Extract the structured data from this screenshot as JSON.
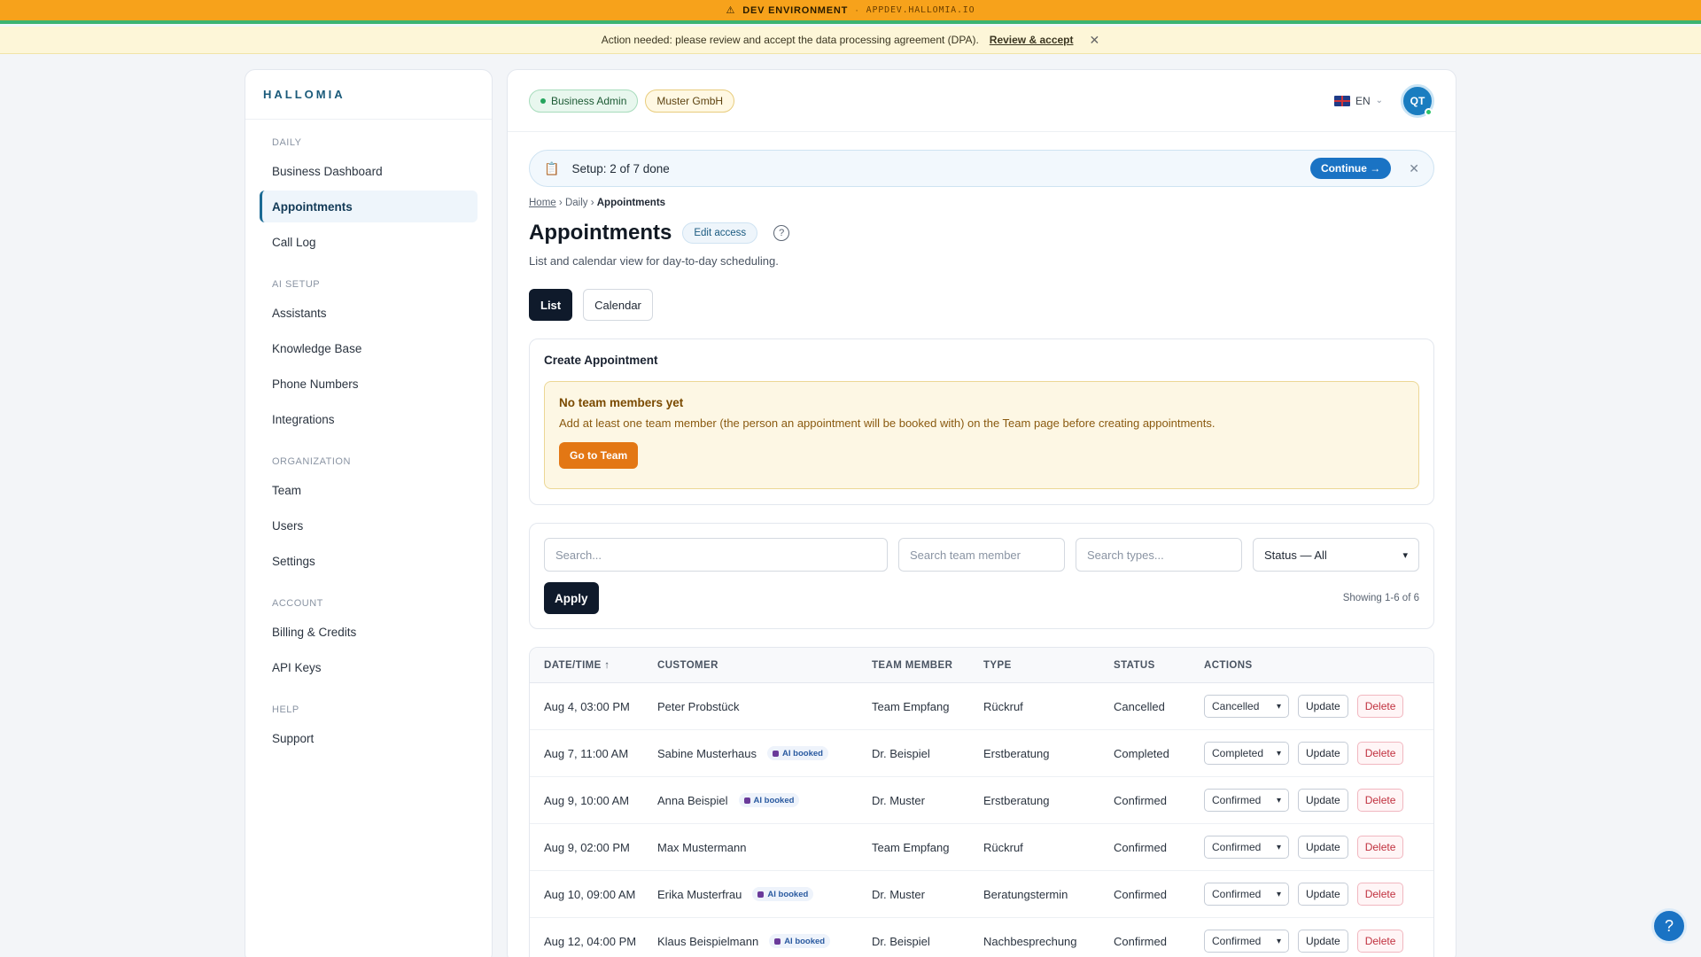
{
  "dev_banner": {
    "icon": "warning-icon",
    "env": "DEV ENVIRONMENT",
    "sep": "·",
    "host": "APPDEV.HALLOMIA.IO"
  },
  "notice": {
    "text": "Action needed: please review and accept the data processing agreement (DPA).",
    "link": "Review & accept",
    "close": "✕"
  },
  "sidebar": {
    "brand": "HALLOMIA",
    "sections": [
      {
        "heading": "DAILY",
        "items": [
          "Business Dashboard",
          "Appointments",
          "Call Log"
        ]
      },
      {
        "heading": "AI SETUP",
        "items": [
          "Assistants",
          "Knowledge Base",
          "Phone Numbers",
          "Integrations"
        ]
      },
      {
        "heading": "ORGANIZATION",
        "items": [
          "Team",
          "Users",
          "Settings"
        ]
      },
      {
        "heading": "ACCOUNT",
        "items": [
          "Billing & Credits",
          "API Keys"
        ]
      },
      {
        "heading": "HELP",
        "items": [
          "Support"
        ]
      }
    ],
    "active_item": "Appointments"
  },
  "header": {
    "role": "Business Admin",
    "org": "Muster GmbH",
    "lang": "EN",
    "avatar": "QT"
  },
  "setup": {
    "icon": "clipboard-icon",
    "text": "Setup: 2 of 7 done",
    "continue": "Continue →",
    "close": "✕"
  },
  "breadcrumb": {
    "home": "Home",
    "sep": "›",
    "daily": "Daily",
    "current": "Appointments"
  },
  "page": {
    "title": "Appointments",
    "edit_access": "Edit access",
    "help": "?",
    "subtitle": "List and calendar view for day-to-day scheduling."
  },
  "view_toggle": {
    "list": "List",
    "calendar": "Calendar",
    "active": "List"
  },
  "create": {
    "title": "Create Appointment",
    "warning_title": "No team members yet",
    "warning_text": "Add at least one team member (the person an appointment will be booked with) on the Team page before creating appointments.",
    "button": "Go to Team"
  },
  "filters": {
    "search_placeholder": "Search...",
    "team_placeholder": "Search team member",
    "types_placeholder": "Search types...",
    "status_value": "Status — All",
    "apply": "Apply",
    "showing": "Showing 1-6 of 6"
  },
  "table": {
    "headers": {
      "date": "DATE/TIME ↑",
      "customer": "CUSTOMER",
      "team": "TEAM MEMBER",
      "type": "TYPE",
      "status": "STATUS",
      "actions": "ACTIONS"
    },
    "ai_badge": "AI booked",
    "update": "Update",
    "delete": "Delete",
    "rows": [
      {
        "date": "Aug 4, 03:00 PM",
        "customer": "Peter Probstück",
        "ai": false,
        "team": "Team Empfang",
        "type": "Rückruf",
        "status": "Cancelled"
      },
      {
        "date": "Aug 7, 11:00 AM",
        "customer": "Sabine Musterhaus",
        "ai": true,
        "team": "Dr. Beispiel",
        "type": "Erstberatung",
        "status": "Completed"
      },
      {
        "date": "Aug 9, 10:00 AM",
        "customer": "Anna Beispiel",
        "ai": true,
        "team": "Dr. Muster",
        "type": "Erstberatung",
        "status": "Confirmed"
      },
      {
        "date": "Aug 9, 02:00 PM",
        "customer": "Max Mustermann",
        "ai": false,
        "team": "Team Empfang",
        "type": "Rückruf",
        "status": "Confirmed"
      },
      {
        "date": "Aug 10, 09:00 AM",
        "customer": "Erika Musterfrau",
        "ai": true,
        "team": "Dr. Muster",
        "type": "Beratungstermin",
        "status": "Confirmed"
      },
      {
        "date": "Aug 12, 04:00 PM",
        "customer": "Klaus Beispielmann",
        "ai": true,
        "team": "Dr. Beispiel",
        "type": "Nachbesprechung",
        "status": "Confirmed"
      }
    ]
  },
  "help_fab": "?",
  "colors": {
    "accent": "#1a73c4",
    "dev_banner": "#f7a21b",
    "warning_button": "#e37714",
    "delete": "#c0303e"
  }
}
